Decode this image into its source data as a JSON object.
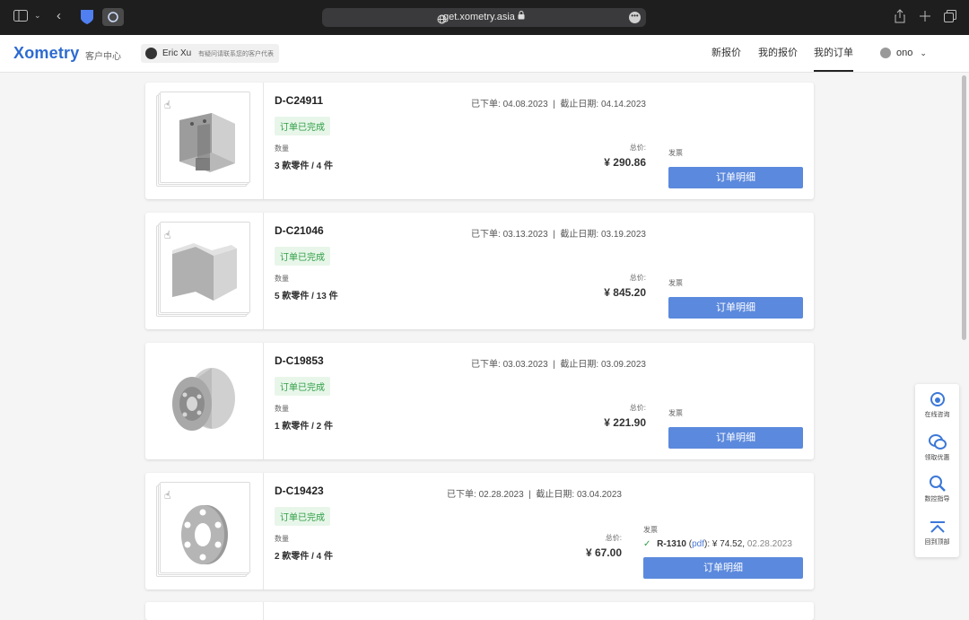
{
  "browser": {
    "url": "get.xometry.asia",
    "icons": [
      "sidebar-icon",
      "chevron-down-icon",
      "back-icon",
      "bitwarden-icon",
      "privacy-icon",
      "globe-icon",
      "lock-icon",
      "more-icon",
      "share-icon",
      "new-tab-icon",
      "tabs-icon"
    ]
  },
  "header": {
    "logo": "Xometry",
    "customer_center": "客户中心",
    "rep_name": "Eric Xu",
    "rep_sub": "有疑问请联系您的客户代表",
    "nav": [
      "新报价",
      "我的报价",
      "我的订单"
    ],
    "active_nav": "我的订单",
    "user": "ono"
  },
  "labels": {
    "placed": "已下单:",
    "deadline": "截止日期:",
    "separator": "|",
    "qty": "数量",
    "total": "总价:",
    "invoice": "发票",
    "detail": "订单明细"
  },
  "orders": [
    {
      "id": "D-C24911",
      "placed": "04.08.2023",
      "deadline": "04.14.2023",
      "status": "订单已完成",
      "qty": "3 款零件 / 4 件",
      "total": "¥ 290.86",
      "thumb": "bracket-part"
    },
    {
      "id": "D-C21046",
      "placed": "03.13.2023",
      "deadline": "03.19.2023",
      "status": "订单已完成",
      "qty": "5 款零件 / 13 件",
      "total": "¥ 845.20",
      "thumb": "corner-part"
    },
    {
      "id": "D-C19853",
      "placed": "03.03.2023",
      "deadline": "03.09.2023",
      "status": "订单已完成",
      "qty": "1 款零件 / 2 件",
      "total": "¥ 221.90",
      "thumb": "pulley-part"
    },
    {
      "id": "D-C19423",
      "placed": "02.28.2023",
      "deadline": "03.04.2023",
      "status": "订单已完成",
      "qty": "2 款零件 / 4 件",
      "total": "¥ 67.00",
      "thumb": "flange-part",
      "invoice": {
        "code": "R-1310",
        "pdf": "pdf",
        "amount": "¥ 74.52",
        "date": "02.28.2023"
      }
    }
  ],
  "side_panel": [
    "在线咨询",
    "领取优惠",
    "数控指导",
    "回到顶部"
  ],
  "colors": {
    "accent": "#5b89dd",
    "status_green": "#2e9e44",
    "logo_blue": "#2d6bd1"
  }
}
